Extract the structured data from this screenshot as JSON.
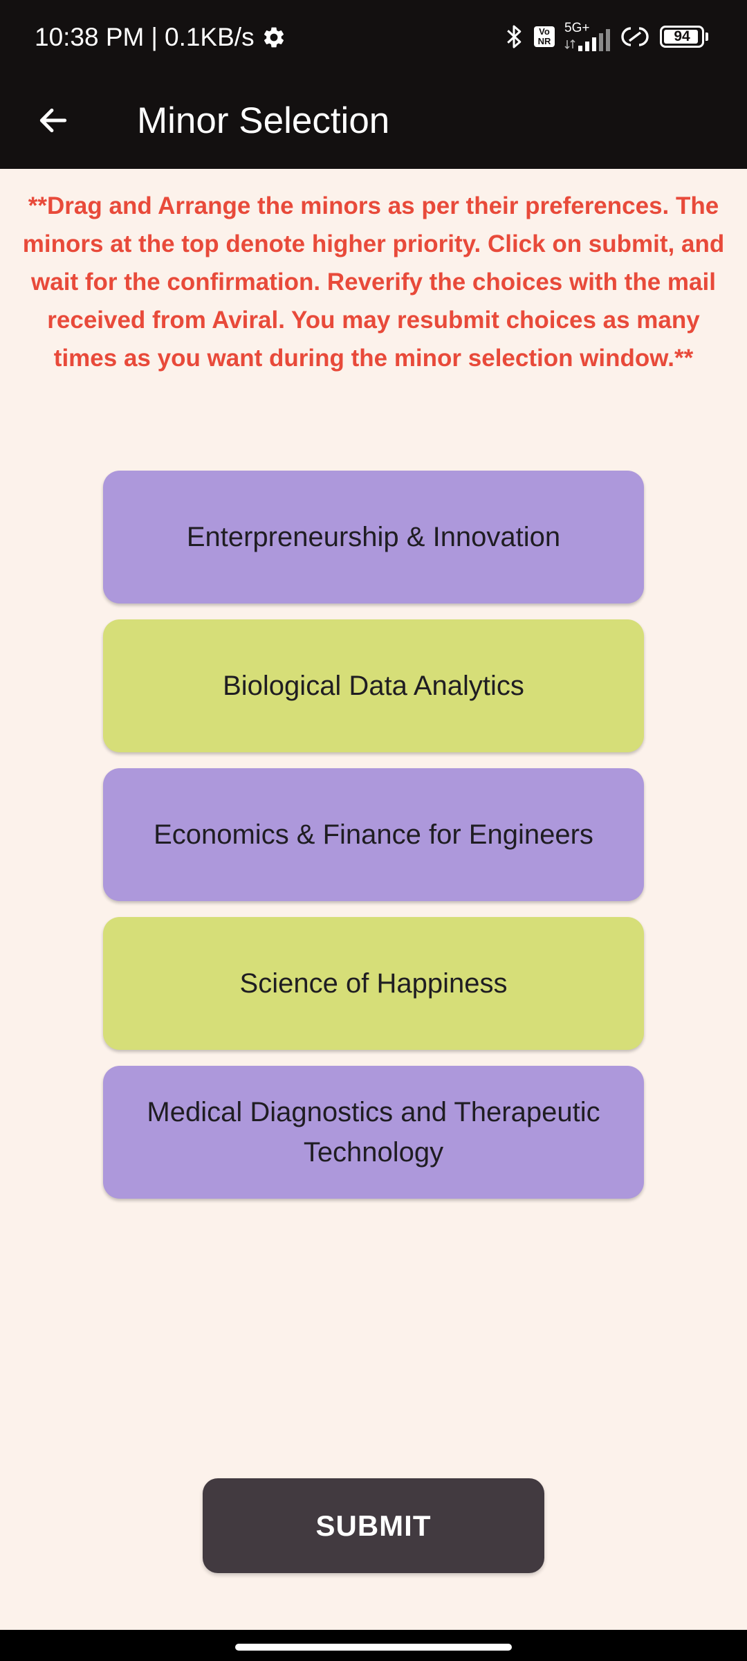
{
  "status_bar": {
    "time": "10:38 PM",
    "separator": "|",
    "speed": "0.1KB/s",
    "network_label": "5G+",
    "volte_label_top": "Vo",
    "volte_label_bottom": "NR",
    "battery": "94",
    "battery_level": 0.94,
    "icons": [
      "settings-gear-icon",
      "bluetooth-icon",
      "vonr-icon",
      "signal-icon",
      "hotspot-icon",
      "battery-icon"
    ]
  },
  "app_bar": {
    "title": "Minor Selection",
    "back_icon": "back-arrow-icon"
  },
  "instructions": "**Drag and Arrange the minors as per their preferences. The minors at the top denote higher priority. Click on submit, and wait for the confirmation. Reverify the choices with the mail received from Aviral. You may resubmit choices as many times as you want during the minor selection window.**",
  "minors": [
    {
      "label": "Enterpreneurship & Innovation",
      "color": "#AD98DB"
    },
    {
      "label": "Biological Data Analytics",
      "color": "#D6DE78"
    },
    {
      "label": "Economics & Finance for Engineers",
      "color": "#AD98DB"
    },
    {
      "label": "Science of Happiness",
      "color": "#D6DE78"
    },
    {
      "label": "Medical Diagnostics and Therapeutic Technology",
      "color": "#AD98DB"
    }
  ],
  "submit_label": "SUBMIT",
  "colors": {
    "background": "#FCF2EB",
    "app_bar": "#131010",
    "instructions_text": "#E84A3A",
    "submit_button": "#423A40"
  }
}
